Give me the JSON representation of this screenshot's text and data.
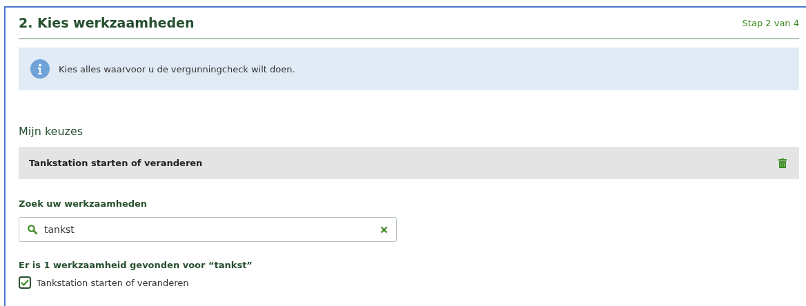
{
  "header": {
    "title": "2. Kies werkzaamheden",
    "step": "Stap 2 van 4"
  },
  "info": {
    "text": "Kies alles waarvoor u de vergunningcheck wilt doen."
  },
  "choices": {
    "heading": "Mijn keuzes",
    "items": [
      {
        "label": "Tankstation starten of veranderen"
      }
    ]
  },
  "search": {
    "label": "Zoek uw werkzaamheden",
    "value": "tankst",
    "result_text": "Er is 1 werkzaamheid gevonden voor “tankst”"
  },
  "results": [
    {
      "label": "Tankstation starten of veranderen",
      "checked": true
    }
  ]
}
